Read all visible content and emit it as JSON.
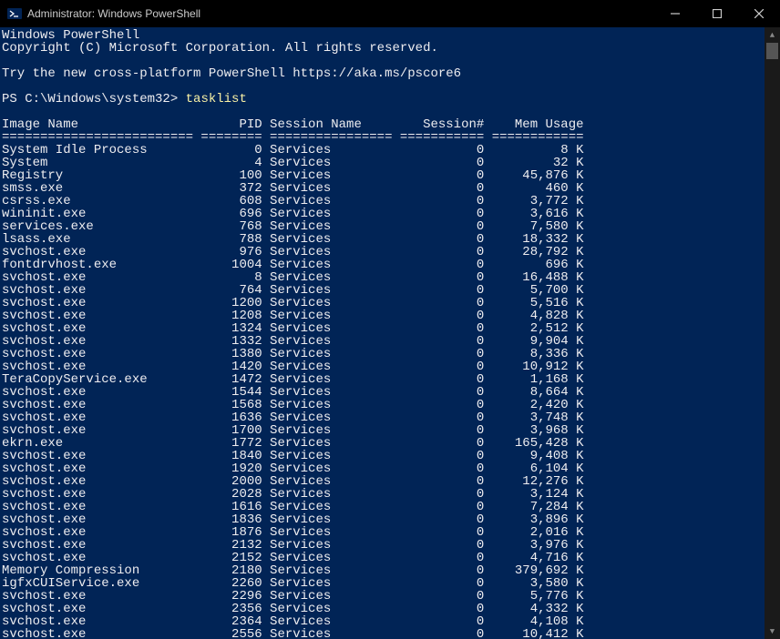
{
  "window": {
    "title": "Administrator: Windows PowerShell"
  },
  "intro": {
    "line1": "Windows PowerShell",
    "line2": "Copyright (C) Microsoft Corporation. All rights reserved.",
    "line3": "Try the new cross-platform PowerShell https://aka.ms/pscore6"
  },
  "prompt": {
    "path": "PS C:\\Windows\\system32>",
    "command": "tasklist"
  },
  "headers": {
    "image": "Image Name",
    "pid": "PID",
    "session_name": "Session Name",
    "session_num": "Session#",
    "mem": "Mem Usage"
  },
  "ruler": {
    "c1": "=========================",
    "c2": "========",
    "c3": "================",
    "c4": "===========",
    "c5": "============"
  },
  "rows": [
    {
      "image": "System Idle Process",
      "pid": 0,
      "session": "Services",
      "snum": 0,
      "mem": "8 K"
    },
    {
      "image": "System",
      "pid": 4,
      "session": "Services",
      "snum": 0,
      "mem": "32 K"
    },
    {
      "image": "Registry",
      "pid": 100,
      "session": "Services",
      "snum": 0,
      "mem": "45,876 K"
    },
    {
      "image": "smss.exe",
      "pid": 372,
      "session": "Services",
      "snum": 0,
      "mem": "460 K"
    },
    {
      "image": "csrss.exe",
      "pid": 608,
      "session": "Services",
      "snum": 0,
      "mem": "3,772 K"
    },
    {
      "image": "wininit.exe",
      "pid": 696,
      "session": "Services",
      "snum": 0,
      "mem": "3,616 K"
    },
    {
      "image": "services.exe",
      "pid": 768,
      "session": "Services",
      "snum": 0,
      "mem": "7,580 K"
    },
    {
      "image": "lsass.exe",
      "pid": 788,
      "session": "Services",
      "snum": 0,
      "mem": "18,332 K"
    },
    {
      "image": "svchost.exe",
      "pid": 976,
      "session": "Services",
      "snum": 0,
      "mem": "28,792 K"
    },
    {
      "image": "fontdrvhost.exe",
      "pid": 1004,
      "session": "Services",
      "snum": 0,
      "mem": "696 K"
    },
    {
      "image": "svchost.exe",
      "pid": 8,
      "session": "Services",
      "snum": 0,
      "mem": "16,488 K"
    },
    {
      "image": "svchost.exe",
      "pid": 764,
      "session": "Services",
      "snum": 0,
      "mem": "5,700 K"
    },
    {
      "image": "svchost.exe",
      "pid": 1200,
      "session": "Services",
      "snum": 0,
      "mem": "5,516 K"
    },
    {
      "image": "svchost.exe",
      "pid": 1208,
      "session": "Services",
      "snum": 0,
      "mem": "4,828 K"
    },
    {
      "image": "svchost.exe",
      "pid": 1324,
      "session": "Services",
      "snum": 0,
      "mem": "2,512 K"
    },
    {
      "image": "svchost.exe",
      "pid": 1332,
      "session": "Services",
      "snum": 0,
      "mem": "9,904 K"
    },
    {
      "image": "svchost.exe",
      "pid": 1380,
      "session": "Services",
      "snum": 0,
      "mem": "8,336 K"
    },
    {
      "image": "svchost.exe",
      "pid": 1420,
      "session": "Services",
      "snum": 0,
      "mem": "10,912 K"
    },
    {
      "image": "TeraCopyService.exe",
      "pid": 1472,
      "session": "Services",
      "snum": 0,
      "mem": "1,168 K"
    },
    {
      "image": "svchost.exe",
      "pid": 1544,
      "session": "Services",
      "snum": 0,
      "mem": "8,664 K"
    },
    {
      "image": "svchost.exe",
      "pid": 1568,
      "session": "Services",
      "snum": 0,
      "mem": "2,420 K"
    },
    {
      "image": "svchost.exe",
      "pid": 1636,
      "session": "Services",
      "snum": 0,
      "mem": "3,748 K"
    },
    {
      "image": "svchost.exe",
      "pid": 1700,
      "session": "Services",
      "snum": 0,
      "mem": "3,968 K"
    },
    {
      "image": "ekrn.exe",
      "pid": 1772,
      "session": "Services",
      "snum": 0,
      "mem": "165,428 K"
    },
    {
      "image": "svchost.exe",
      "pid": 1840,
      "session": "Services",
      "snum": 0,
      "mem": "9,408 K"
    },
    {
      "image": "svchost.exe",
      "pid": 1920,
      "session": "Services",
      "snum": 0,
      "mem": "6,104 K"
    },
    {
      "image": "svchost.exe",
      "pid": 2000,
      "session": "Services",
      "snum": 0,
      "mem": "12,276 K"
    },
    {
      "image": "svchost.exe",
      "pid": 2028,
      "session": "Services",
      "snum": 0,
      "mem": "3,124 K"
    },
    {
      "image": "svchost.exe",
      "pid": 1616,
      "session": "Services",
      "snum": 0,
      "mem": "7,284 K"
    },
    {
      "image": "svchost.exe",
      "pid": 1836,
      "session": "Services",
      "snum": 0,
      "mem": "3,896 K"
    },
    {
      "image": "svchost.exe",
      "pid": 1876,
      "session": "Services",
      "snum": 0,
      "mem": "2,016 K"
    },
    {
      "image": "svchost.exe",
      "pid": 2132,
      "session": "Services",
      "snum": 0,
      "mem": "3,976 K"
    },
    {
      "image": "svchost.exe",
      "pid": 2152,
      "session": "Services",
      "snum": 0,
      "mem": "4,716 K"
    },
    {
      "image": "Memory Compression",
      "pid": 2180,
      "session": "Services",
      "snum": 0,
      "mem": "379,692 K"
    },
    {
      "image": "igfxCUIService.exe",
      "pid": 2260,
      "session": "Services",
      "snum": 0,
      "mem": "3,580 K"
    },
    {
      "image": "svchost.exe",
      "pid": 2296,
      "session": "Services",
      "snum": 0,
      "mem": "5,776 K"
    },
    {
      "image": "svchost.exe",
      "pid": 2356,
      "session": "Services",
      "snum": 0,
      "mem": "4,332 K"
    },
    {
      "image": "svchost.exe",
      "pid": 2364,
      "session": "Services",
      "snum": 0,
      "mem": "4,108 K"
    },
    {
      "image": "svchost.exe",
      "pid": 2556,
      "session": "Services",
      "snum": 0,
      "mem": "10,412 K"
    }
  ]
}
